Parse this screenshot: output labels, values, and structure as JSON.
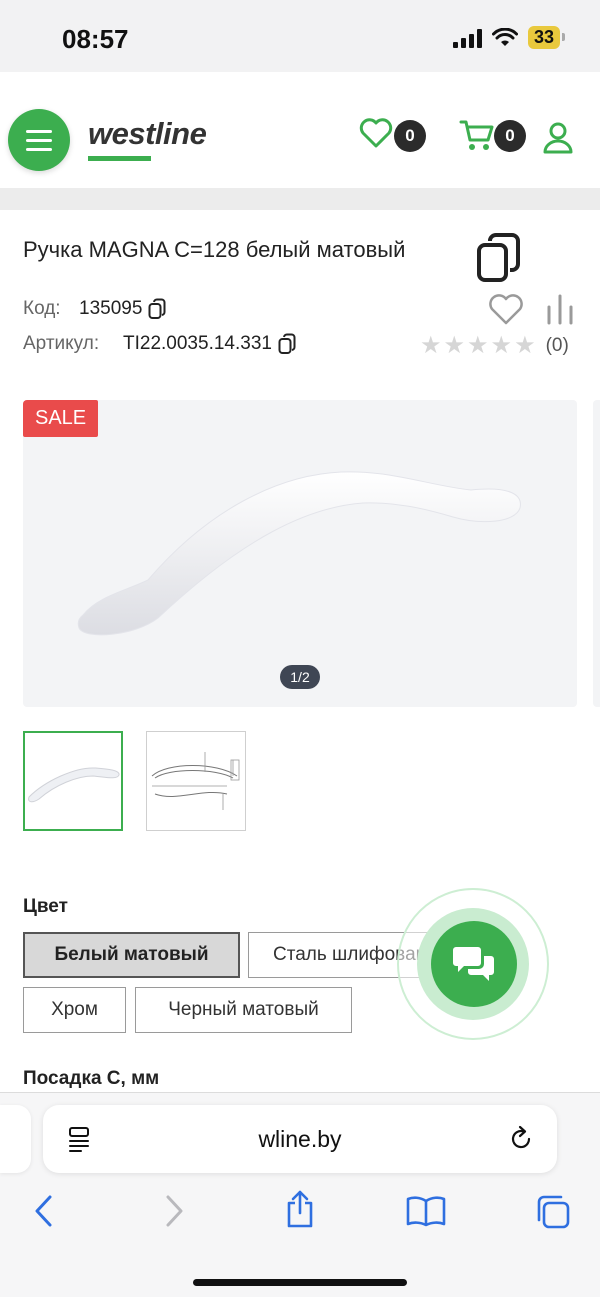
{
  "status": {
    "time": "08:57",
    "battery": "33"
  },
  "header": {
    "logo": "westline",
    "favorites_count": "0",
    "cart_count": "0"
  },
  "product": {
    "title": "Ручка MAGNA C=128 белый матовый",
    "code_label": "Код:",
    "code_value": "135095",
    "article_label": "Артикул:",
    "article_value": "TI22.0035.14.331",
    "rating_count": "(0)",
    "sale_badge": "SALE",
    "image_counter": "1/2"
  },
  "color": {
    "label": "Цвет",
    "options": [
      "Белый матовый",
      "Сталь шлифован",
      "Хром",
      "Черный матовый"
    ],
    "selected": "Белый матовый"
  },
  "seat": {
    "label": "Посадка С, мм"
  },
  "browser": {
    "url": "wline.by"
  },
  "colors": {
    "brand_green": "#3cae4f",
    "sale_red": "#e94b4b"
  }
}
